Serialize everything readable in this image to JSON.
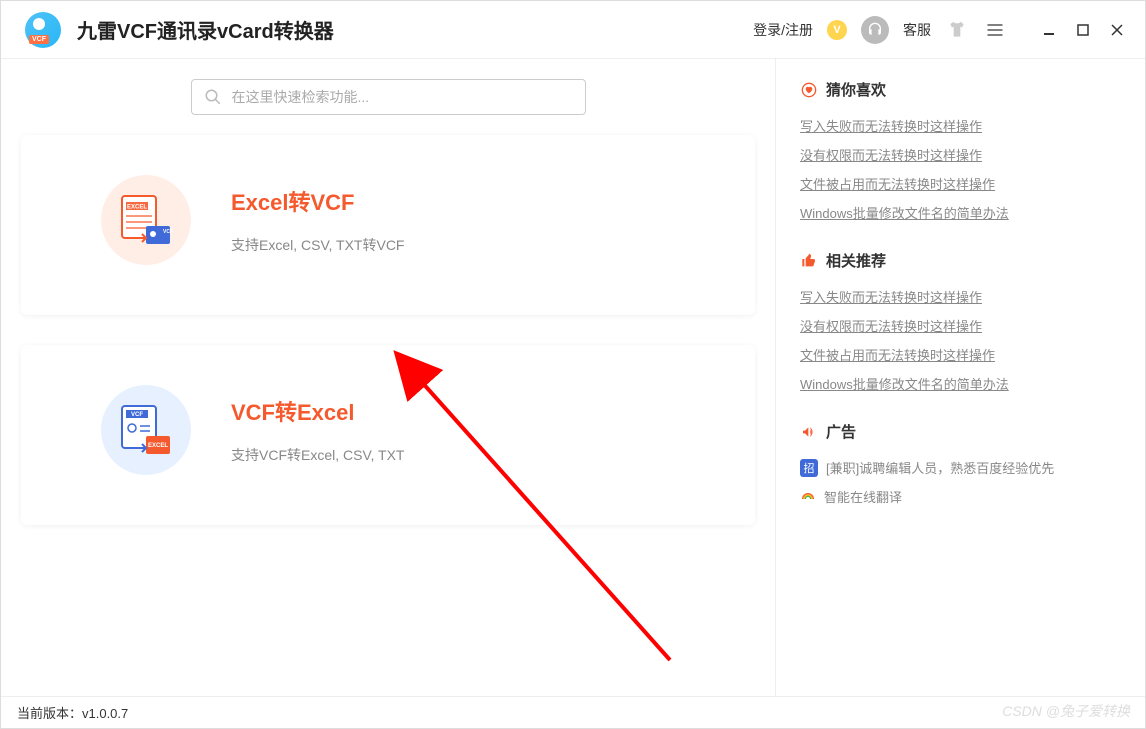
{
  "titlebar": {
    "app_title": "九雷VCF通讯录vCard转换器",
    "login_label": "登录/注册",
    "service_label": "客服"
  },
  "search": {
    "placeholder": "在这里快速检索功能..."
  },
  "cards": [
    {
      "title": "Excel转VCF",
      "subtitle": "支持Excel, CSV, TXT转VCF"
    },
    {
      "title": "VCF转Excel",
      "subtitle": "支持VCF转Excel, CSV, TXT"
    }
  ],
  "sidebar": {
    "favorites": {
      "title": "猜你喜欢",
      "links": [
        "写入失败而无法转换时这样操作",
        "没有权限而无法转换时这样操作",
        "文件被占用而无法转换时这样操作",
        "Windows批量修改文件名的简单办法"
      ]
    },
    "related": {
      "title": "相关推荐",
      "links": [
        "写入失败而无法转换时这样操作",
        "没有权限而无法转换时这样操作",
        "文件被占用而无法转换时这样操作",
        "Windows批量修改文件名的简单办法"
      ]
    },
    "ads": {
      "title": "广告",
      "items": [
        {
          "badge": "招",
          "text": "[兼职]诚聘编辑人员，熟悉百度经验优先"
        },
        {
          "badge": "",
          "text": "智能在线翻译"
        }
      ]
    }
  },
  "statusbar": {
    "version_label": "当前版本：v1.0.0.7"
  },
  "watermark": "CSDN @兔子爱转换"
}
